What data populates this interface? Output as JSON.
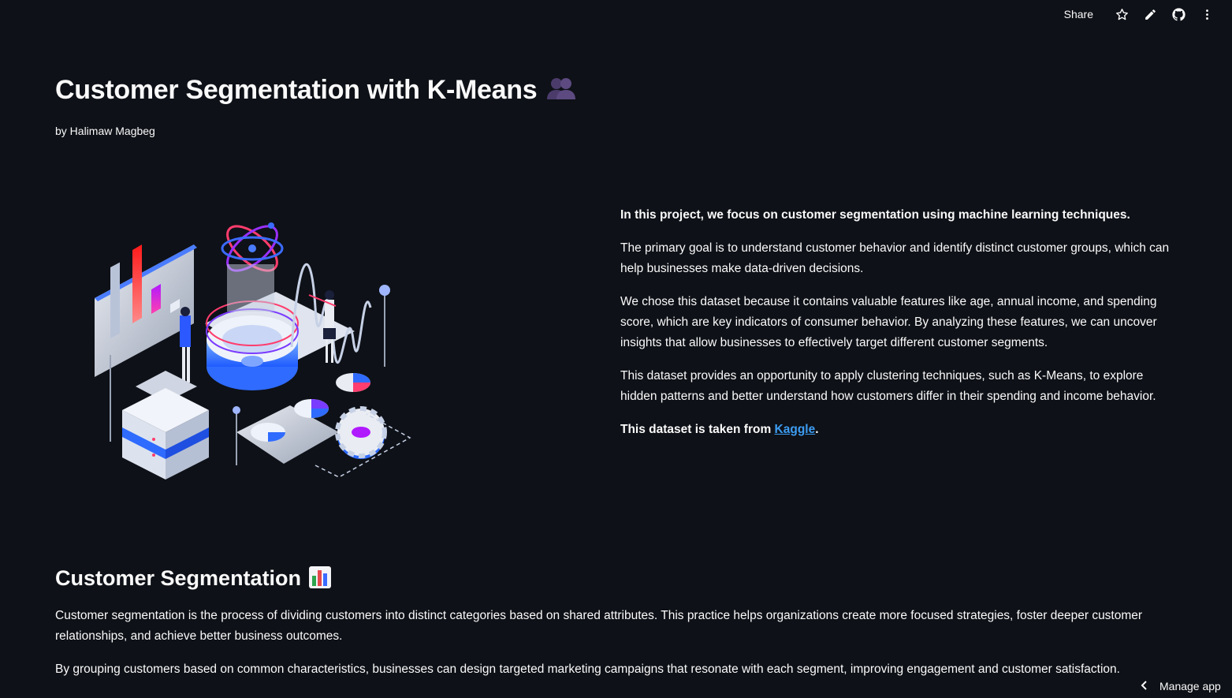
{
  "toolbar": {
    "share_label": "Share",
    "icons": [
      "star-icon",
      "pencil-icon",
      "github-icon",
      "more-vertical-icon"
    ]
  },
  "page": {
    "title": "Customer Segmentation with K-Means",
    "title_emoji": "busts-in-silhouette",
    "byline": "by Halimaw Magbeg"
  },
  "intro": {
    "p1": "In this project, we focus on customer segmentation using machine learning techniques.",
    "p2": "The primary goal is to understand customer behavior and identify distinct customer groups, which can help businesses make data-driven decisions.",
    "p3": "We chose this dataset because it contains valuable features like age, annual income, and spending score, which are key indicators of consumer behavior. By analyzing these features, we can uncover insights that allow businesses to effectively target different customer segments.",
    "p4": "This dataset provides an opportunity to apply clustering techniques, such as K-Means, to explore hidden patterns and better understand how customers differ in their spending and income behavior.",
    "source_prefix": "This dataset is taken from ",
    "source_link": "Kaggle",
    "source_suffix": "."
  },
  "section": {
    "title": "Customer Segmentation",
    "title_emoji": "bar-chart",
    "p1": "Customer segmentation is the process of dividing customers into distinct categories based on shared attributes. This practice helps organizations create more focused strategies, foster deeper customer relationships, and achieve better business outcomes.",
    "p2": "By grouping customers based on common characteristics, businesses can design targeted marketing campaigns that resonate with each segment, improving engagement and customer satisfaction."
  },
  "footer": {
    "manage_label": "Manage app"
  },
  "colors": {
    "background": "#0e1117",
    "text": "#fafafa",
    "link": "#3d9df3",
    "accent_blue": "#2f6bff",
    "accent_red": "#ff2b2b",
    "accent_purple": "#a020f0"
  }
}
